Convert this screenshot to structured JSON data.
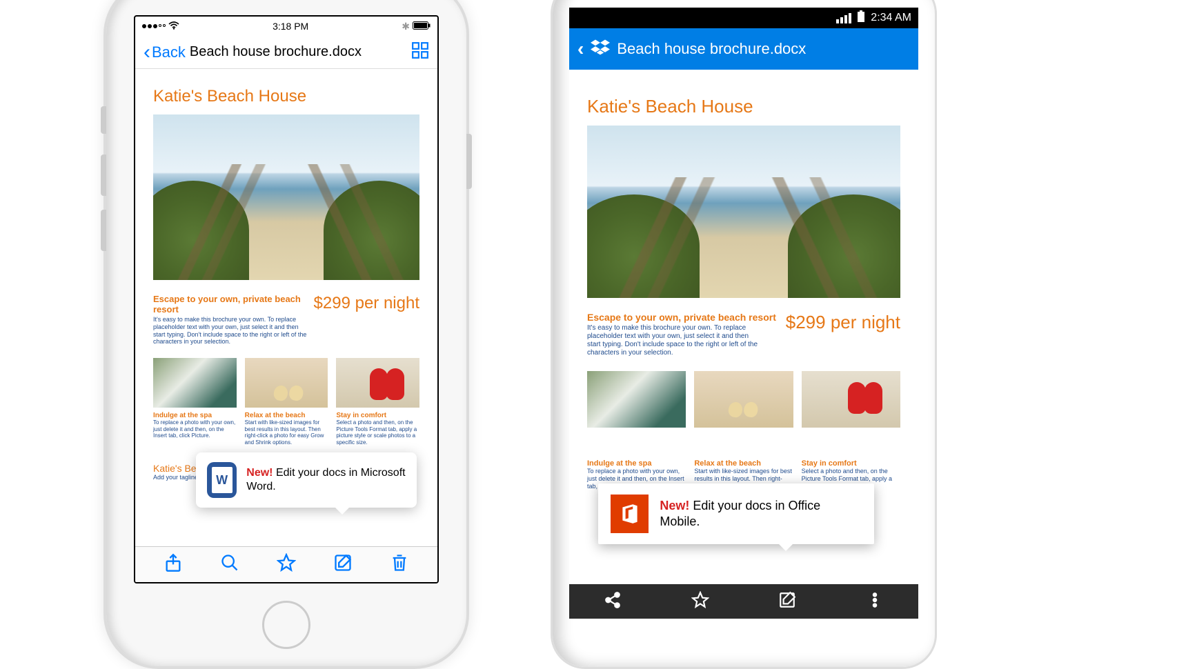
{
  "ios": {
    "status": {
      "time": "3:18 PM"
    },
    "nav": {
      "back": "Back",
      "title": "Beach house brochure.docx"
    },
    "doc": {
      "title": "Katie's Beach House",
      "escape_head": "Escape to your own, private beach resort",
      "escape_body": "It's easy to make this brochure your own. To replace placeholder text with your own, just select it and then start typing. Don't include space to the right or left of the characters in your selection.",
      "price": "$299 per night",
      "thumbs": [
        {
          "cap": "Indulge at the spa",
          "desc": "To replace a photo with your own, just delete it and then, on the Insert tab, click Picture."
        },
        {
          "cap": "Relax at the beach",
          "desc": "Start with like-sized images for best results in this layout. Then right-click a photo for easy Grow and Shrink options."
        },
        {
          "cap": "Stay in comfort",
          "desc": "Select a photo and then, on the Picture Tools Format tab, apply a picture style or scale photos to a specific size."
        }
      ],
      "sub_title_partial": "Katie's Bea",
      "sub_line": "Add your tagline or"
    },
    "tooltip": {
      "new": "New!",
      "text": " Edit your docs in Microsoft Word."
    }
  },
  "android": {
    "status": {
      "time": "2:34 AM"
    },
    "nav": {
      "title": "Beach house brochure.docx"
    },
    "doc": {
      "title": "Katie's Beach House",
      "escape_head": "Escape to your own, private beach resort",
      "escape_body": "It's easy to make this brochure your own. To replace placeholder text with your own, just select it and then start typing. Don't include space to the right or left of the characters in your selection.",
      "price": "$299 per night",
      "thumbs": [
        {
          "cap": "Indulge at the spa",
          "desc": "To replace a photo with your own, just delete it and then, on the Insert tab,"
        },
        {
          "cap": "Relax at the beach",
          "desc": "Start with like-sized images for best results in this layout. Then right-click a"
        },
        {
          "cap": "Stay in comfort",
          "desc": "Select a photo and then, on the Picture Tools Format tab, apply a picture style"
        }
      ]
    },
    "tooltip": {
      "new": "New!",
      "text": " Edit your docs in Office Mobile."
    }
  }
}
